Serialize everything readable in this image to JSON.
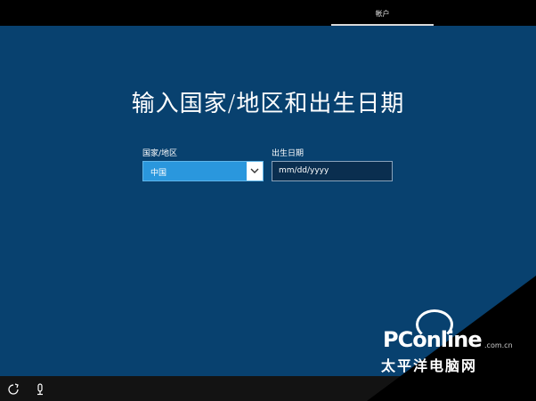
{
  "header": {
    "tab_label": "帐户"
  },
  "main": {
    "title": "输入国家/地区和出生日期",
    "country": {
      "label": "国家/地区",
      "value": "中国"
    },
    "birthdate": {
      "label": "出生日期",
      "placeholder": "mm/dd/yyyy"
    }
  },
  "footer": {
    "icons": [
      "ease-of-access-icon",
      "microphone-icon"
    ]
  },
  "watermark": {
    "brand": "PConline",
    "domain": ".com.cn",
    "subtitle": "太平洋电脑网"
  },
  "colors": {
    "background": "#08416f",
    "accent": "#2a97dd",
    "topbar": "#000000",
    "bottombar": "#131313"
  }
}
